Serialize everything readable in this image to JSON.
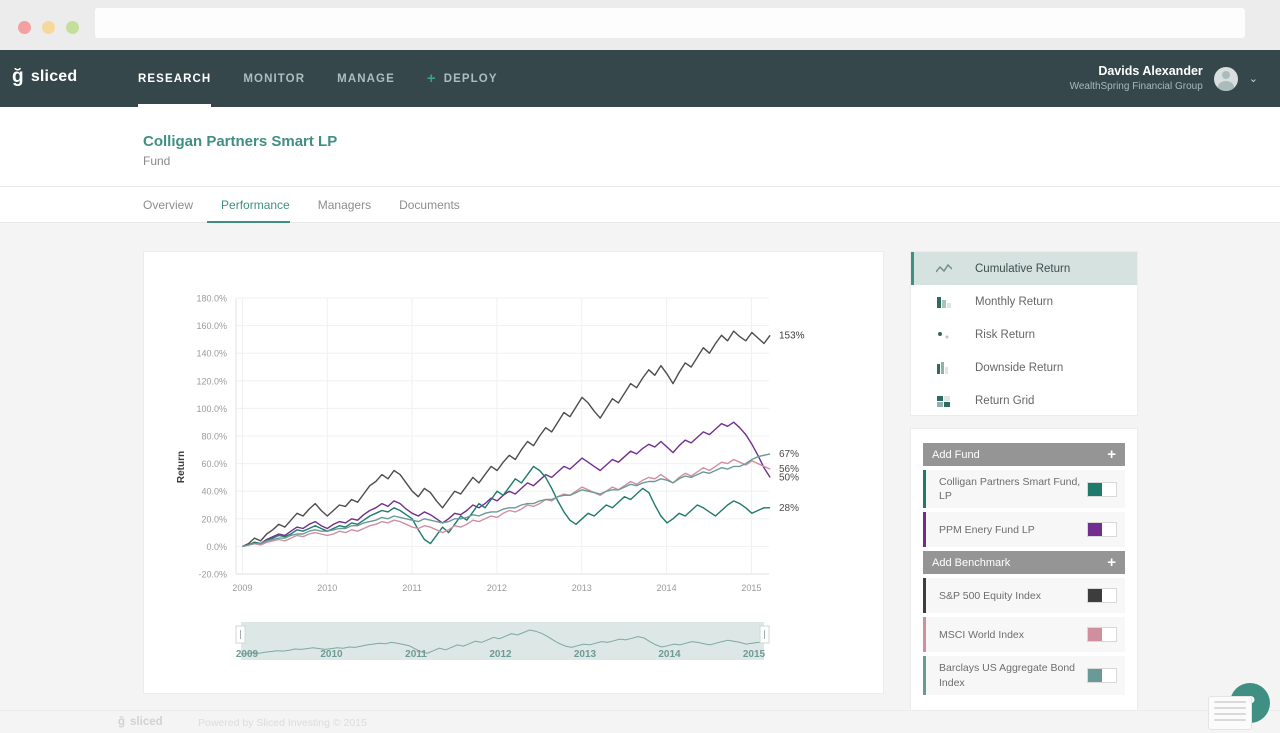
{
  "browser": {
    "traffic_lights": [
      "close",
      "minimize",
      "maximize"
    ],
    "url_value": "",
    "url_placeholder": ""
  },
  "topnav": {
    "brand": "sliced",
    "items": [
      {
        "label": "RESEARCH",
        "active": true,
        "icon": ""
      },
      {
        "label": "MONITOR",
        "active": false,
        "icon": ""
      },
      {
        "label": "MANAGE",
        "active": false,
        "icon": ""
      },
      {
        "label": "DEPLOY",
        "active": false,
        "icon": "plus-icon"
      }
    ],
    "user": {
      "name": "Davids Alexander",
      "org": "WealthSpring Financial Group",
      "chevron": "⌄"
    }
  },
  "fund_header": {
    "name": "Colligan Partners Smart LP",
    "subtitle": "Fund"
  },
  "tabs": [
    {
      "label": "Overview",
      "active": false
    },
    {
      "label": "Performance",
      "active": true
    },
    {
      "label": "Managers",
      "active": false
    },
    {
      "label": "Documents",
      "active": false
    }
  ],
  "analysis_menu": [
    {
      "label": "Cumulative Return",
      "icon": "line-chart-icon",
      "active": true
    },
    {
      "label": "Monthly Return",
      "icon": "bar-chart-icon",
      "active": false
    },
    {
      "label": "Risk Return",
      "icon": "scatter-plot-icon",
      "active": false
    },
    {
      "label": "Downside Return",
      "icon": "downside-bar-icon",
      "active": false
    },
    {
      "label": "Return Grid",
      "icon": "grid-icon",
      "active": false
    }
  ],
  "selection_panel": {
    "add_fund_label": "Add Fund",
    "add_benchmark_label": "Add Benchmark",
    "plus_glyph": "+",
    "funds": [
      {
        "name": "Colligan Partners Smart Fund, LP",
        "color": "#1f7a6b",
        "enabled": true
      },
      {
        "name": "PPM Enery Fund LP",
        "color": "#722e8f",
        "enabled": true
      }
    ],
    "benchmarks": [
      {
        "name": "S&P 500 Equity Index",
        "color": "#3d3d3d",
        "enabled": true
      },
      {
        "name": "MSCI World Index",
        "color": "#d08f9e",
        "enabled": true
      },
      {
        "name": "Barclays US Aggregate Bond Index",
        "color": "#6a9a98",
        "enabled": true
      }
    ]
  },
  "footer": {
    "brand": "sliced",
    "text": "Powered by Sliced Investing © 2015"
  },
  "help": {
    "glyph": "?"
  },
  "chart_data": {
    "type": "line",
    "title": "",
    "xlabel": "",
    "ylabel": "Return",
    "ylim": [
      -20,
      180
    ],
    "ytick_labels": [
      "180.0%",
      "160.0%",
      "140.0%",
      "120.0%",
      "100.0%",
      "80.0%",
      "60.0%",
      "40.0%",
      "20.0%",
      "0.0%",
      "-20.0%"
    ],
    "ytick_values": [
      180,
      160,
      140,
      120,
      100,
      80,
      60,
      40,
      20,
      0,
      -20
    ],
    "xtick_labels": [
      "2009",
      "2010",
      "2011",
      "2012",
      "2013",
      "2014",
      "2015"
    ],
    "xlim": [
      2009,
      2015.42
    ],
    "grid": true,
    "legend_position": "right-panel",
    "end_labels": [
      {
        "text": "153%",
        "value": 153,
        "color": "#3d3d3d"
      },
      {
        "text": "67%",
        "value": 67,
        "color": "#4a4a4a"
      },
      {
        "text": "56%",
        "value": 56,
        "color": "#4a4a4a"
      },
      {
        "text": "50%",
        "value": 50,
        "color": "#4a4a4a"
      },
      {
        "text": "28%",
        "value": 28,
        "color": "#4a4a4a"
      }
    ],
    "series": [
      {
        "name": "S&P 500 Equity Index",
        "color": "#4d4d4d",
        "final_value": 153,
        "values": [
          0,
          2,
          6,
          4,
          9,
          12,
          16,
          14,
          19,
          24,
          22,
          27,
          31,
          26,
          22,
          26,
          30,
          29,
          34,
          32,
          38,
          44,
          47,
          52,
          49,
          55,
          52,
          46,
          40,
          36,
          42,
          39,
          33,
          28,
          34,
          40,
          38,
          44,
          50,
          46,
          52,
          58,
          55,
          61,
          66,
          63,
          70,
          76,
          73,
          80,
          86,
          83,
          90,
          97,
          94,
          101,
          108,
          104,
          98,
          93,
          100,
          107,
          104,
          111,
          118,
          115,
          122,
          128,
          124,
          131,
          125,
          118,
          126,
          133,
          130,
          137,
          144,
          140,
          147,
          153,
          149,
          156,
          152,
          149,
          155,
          151,
          147,
          153
        ]
      },
      {
        "name": "PPM Enery Fund LP",
        "color": "#722e8f",
        "final_value": 50,
        "values": [
          0,
          1,
          3,
          2,
          5,
          7,
          9,
          8,
          11,
          14,
          13,
          16,
          18,
          15,
          13,
          16,
          18,
          17,
          20,
          19,
          23,
          26,
          28,
          31,
          29,
          33,
          31,
          27,
          24,
          22,
          25,
          23,
          20,
          17,
          20,
          24,
          23,
          26,
          30,
          28,
          31,
          35,
          33,
          37,
          40,
          38,
          42,
          46,
          44,
          48,
          52,
          50,
          54,
          58,
          56,
          60,
          64,
          61,
          58,
          55,
          59,
          63,
          61,
          65,
          69,
          67,
          71,
          74,
          72,
          76,
          72,
          68,
          73,
          77,
          75,
          79,
          83,
          81,
          85,
          89,
          87,
          90,
          86,
          81,
          74,
          66,
          57,
          50
        ]
      },
      {
        "name": "Colligan Partners Smart Fund, LP",
        "color": "#1f7a6b",
        "final_value": 28,
        "values": [
          0,
          1,
          3,
          2,
          4,
          6,
          8,
          7,
          9,
          12,
          11,
          13,
          15,
          13,
          11,
          13,
          15,
          14,
          17,
          16,
          19,
          22,
          24,
          26,
          25,
          28,
          26,
          23,
          20,
          12,
          5,
          2,
          8,
          14,
          10,
          16,
          22,
          19,
          25,
          31,
          28,
          34,
          40,
          37,
          43,
          49,
          46,
          52,
          58,
          55,
          50,
          42,
          33,
          25,
          19,
          16,
          20,
          24,
          22,
          26,
          30,
          28,
          32,
          36,
          34,
          38,
          42,
          39,
          30,
          22,
          17,
          20,
          24,
          22,
          26,
          30,
          28,
          25,
          22,
          26,
          30,
          33,
          31,
          28,
          24,
          26,
          28,
          28
        ]
      },
      {
        "name": "MSCI World Index",
        "color": "#d08f9e",
        "final_value": 56,
        "values": [
          0,
          1,
          2,
          1,
          3,
          4,
          5,
          4,
          6,
          8,
          7,
          9,
          10,
          9,
          8,
          9,
          11,
          10,
          12,
          11,
          13,
          15,
          16,
          18,
          17,
          19,
          18,
          16,
          14,
          13,
          15,
          14,
          12,
          10,
          12,
          15,
          14,
          16,
          19,
          18,
          20,
          22,
          21,
          24,
          26,
          25,
          27,
          30,
          29,
          31,
          34,
          33,
          36,
          38,
          37,
          40,
          43,
          41,
          39,
          37,
          40,
          43,
          41,
          44,
          47,
          45,
          48,
          50,
          49,
          52,
          49,
          46,
          50,
          53,
          51,
          54,
          57,
          55,
          58,
          61,
          60,
          63,
          61,
          59,
          62,
          60,
          58,
          56
        ]
      },
      {
        "name": "Barclays US Aggregate Bond Index",
        "color": "#6a9a98",
        "final_value": 67,
        "values": [
          0,
          1,
          2,
          2,
          4,
          5,
          6,
          6,
          8,
          9,
          9,
          11,
          12,
          11,
          11,
          12,
          13,
          13,
          15,
          15,
          17,
          18,
          19,
          21,
          20,
          22,
          21,
          20,
          19,
          18,
          20,
          19,
          18,
          17,
          18,
          20,
          20,
          21,
          23,
          22,
          24,
          25,
          25,
          27,
          28,
          28,
          30,
          31,
          31,
          33,
          34,
          34,
          36,
          37,
          37,
          39,
          41,
          40,
          39,
          38,
          40,
          41,
          41,
          43,
          45,
          44,
          46,
          47,
          47,
          49,
          48,
          46,
          49,
          51,
          50,
          52,
          54,
          53,
          55,
          57,
          56,
          58,
          58,
          60,
          63,
          65,
          66,
          67
        ]
      }
    ],
    "navigator": {
      "xtick_labels": [
        "2009",
        "2010",
        "2011",
        "2012",
        "2013",
        "2014",
        "2015"
      ],
      "handles": [
        "left-handle",
        "right-handle"
      ]
    }
  }
}
